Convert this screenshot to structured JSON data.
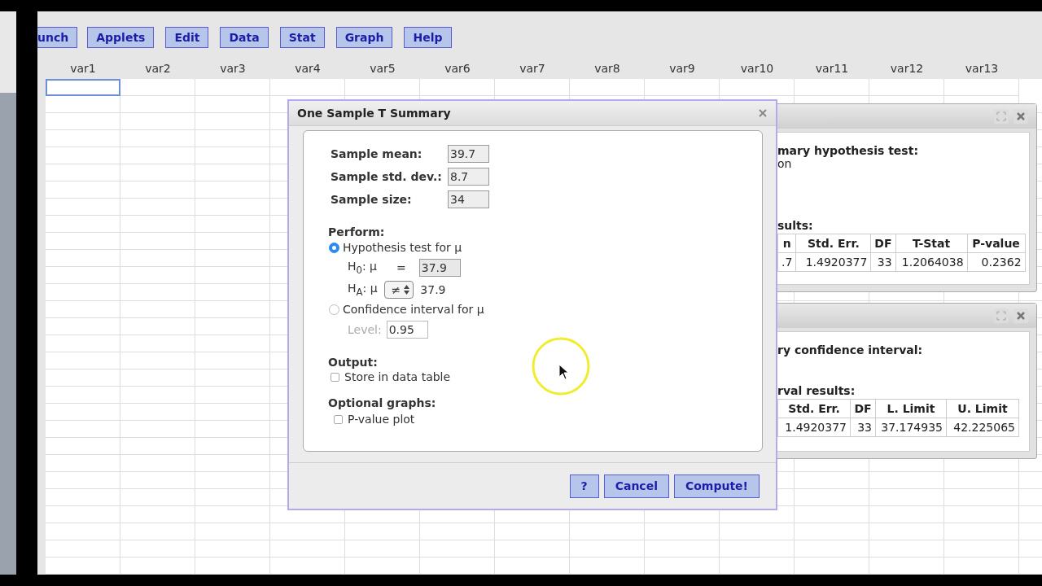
{
  "menu": [
    {
      "label": "unch"
    },
    {
      "label": "Applets"
    },
    {
      "label": "Edit"
    },
    {
      "label": "Data"
    },
    {
      "label": "Stat"
    },
    {
      "label": "Graph"
    },
    {
      "label": "Help"
    }
  ],
  "columns": [
    {
      "label": "var1",
      "selected": true
    },
    {
      "label": "var2",
      "selected": false
    },
    {
      "label": "var3",
      "selected": false
    },
    {
      "label": "var4",
      "selected": false
    },
    {
      "label": "var5",
      "selected": false
    },
    {
      "label": "var6",
      "selected": false
    },
    {
      "label": "var7",
      "selected": false
    },
    {
      "label": "var8",
      "selected": false
    },
    {
      "label": "var9",
      "selected": false
    },
    {
      "label": "var10",
      "selected": false
    },
    {
      "label": "var11",
      "selected": false
    },
    {
      "label": "var12",
      "selected": false
    },
    {
      "label": "var13",
      "selected": false
    }
  ],
  "dialog": {
    "title": "One Sample T Summary",
    "fields": [
      {
        "label": "Sample mean:",
        "value": "39.7"
      },
      {
        "label": "Sample std. dev.:",
        "value": "8.7"
      },
      {
        "label": "Sample size:",
        "value": "34"
      }
    ],
    "perform_heading": "Perform:",
    "options": [
      {
        "label": "Hypothesis test for μ",
        "selected": true
      },
      {
        "label": "Confidence interval for μ",
        "selected": false
      }
    ],
    "h0": {
      "label": "H$_{0}$: μ",
      "operator": "=",
      "value": "37.9"
    },
    "ha": {
      "label": "H$_{A}$: μ",
      "operator": "≠",
      "value": "37.9"
    },
    "level": {
      "label": "Level:",
      "value": "0.95",
      "disabled": true
    },
    "output_heading": "Output:",
    "store": {
      "label": "Store in data table",
      "checked": false
    },
    "graphs_heading": "Optional graphs:",
    "plot": {
      "label": "P-value plot",
      "checked": false
    },
    "buttons": [
      "?",
      "Cancel",
      "Compute!"
    ]
  },
  "results": [
    {
      "heading": "mary hypothesis test:",
      "line": "on",
      "subheading": "sults:",
      "columns": [
        "n",
        "Std. Err.",
        "DF",
        "T-Stat",
        "P-value"
      ],
      "row": [
        ".7",
        "1.4920377",
        "33",
        "1.2064038",
        "0.2362"
      ]
    },
    {
      "heading": "ry confidence interval:",
      "subheading": "rval results:",
      "columns": [
        "Std. Err.",
        "DF",
        "L. Limit",
        "U. Limit"
      ],
      "row": [
        "1.4920377",
        "33",
        "37.174935",
        "42.225065"
      ]
    }
  ]
}
